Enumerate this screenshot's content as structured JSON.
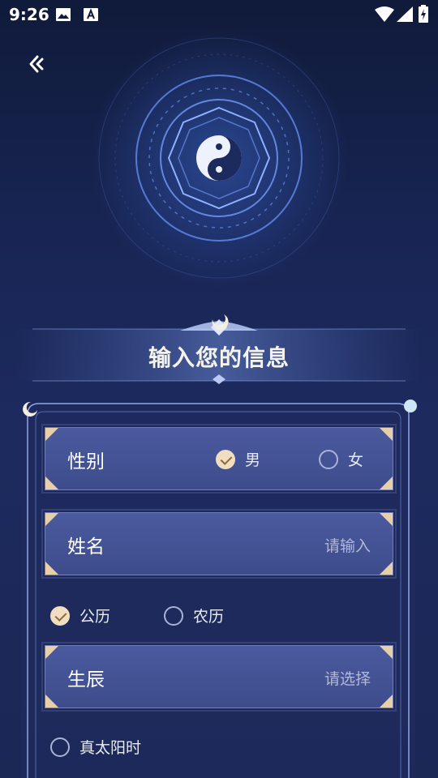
{
  "status_bar": {
    "time": "9:26"
  },
  "title": "输入您的信息",
  "gender": {
    "label": "性别",
    "options": [
      {
        "label": "男",
        "checked": true
      },
      {
        "label": "女",
        "checked": false
      }
    ]
  },
  "name": {
    "label": "姓名",
    "placeholder": "请输入"
  },
  "calendar": {
    "options": [
      {
        "label": "公历",
        "checked": true
      },
      {
        "label": "农历",
        "checked": false
      }
    ]
  },
  "birth": {
    "label": "生辰",
    "placeholder": "请选择"
  },
  "solar_time": {
    "label": "真太阳时",
    "checked": false
  },
  "colors": {
    "accent_gold": "#e6cfa9",
    "field_bg": "#4a5a9e",
    "bg_dark": "#101a3a"
  },
  "icons": [
    "back-icon",
    "image-icon",
    "a-box-icon",
    "wifi-icon",
    "signal-icon",
    "battery-icon",
    "yin-yang-icon",
    "moon-icon"
  ]
}
